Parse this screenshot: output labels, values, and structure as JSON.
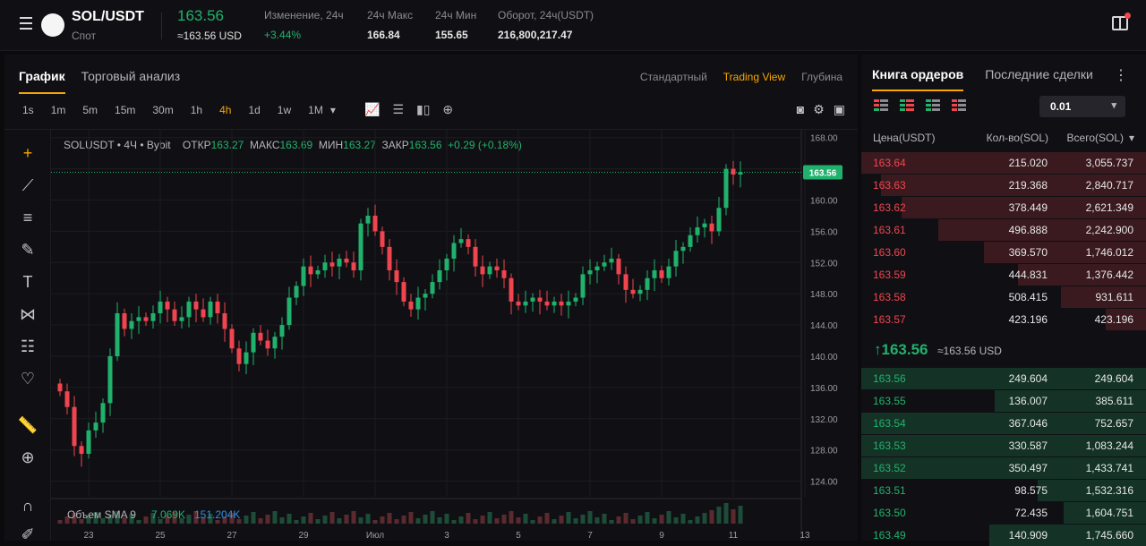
{
  "header": {
    "pair": "SOL/USDT",
    "type": "Спот",
    "price": "163.56",
    "price_usd": "≈163.56 USD",
    "stats": [
      {
        "label": "Изменение, 24ч",
        "value": "+3.44%",
        "positive": true
      },
      {
        "label": "24ч Макс",
        "value": "166.84"
      },
      {
        "label": "24ч Мин",
        "value": "155.65"
      },
      {
        "label": "Оборот, 24ч(USDT)",
        "value": "216,800,217.47"
      }
    ]
  },
  "chart_panel": {
    "tabs": [
      "График",
      "Торговый анализ"
    ],
    "views": [
      "Стандартный",
      "Trading View",
      "Глубина"
    ],
    "intervals": [
      "1s",
      "1m",
      "5m",
      "15m",
      "30m",
      "1h",
      "4h",
      "1d",
      "1w",
      "1M"
    ],
    "active_interval": "4h",
    "legend": {
      "symbol": "SOLUSDT",
      "tf": "4Ч",
      "exchange": "Bybit",
      "open_label": "ОТКР",
      "open": "163.27",
      "high_label": "МАКС",
      "high": "163.69",
      "low_label": "МИН",
      "low": "163.27",
      "close_label": "ЗАКР",
      "close": "163.56",
      "change": "+0.29 (+0.18%)"
    },
    "volume_legend": {
      "label": "Объем SMA 9",
      "v1": "7.069K",
      "v2": "151.204K"
    },
    "price_label": "163.56"
  },
  "chart_data": {
    "type": "candlestick",
    "ylim": [
      122,
      169
    ],
    "y_ticks": [
      124,
      128,
      132,
      136,
      140,
      144,
      148,
      152,
      156,
      160,
      164,
      168
    ],
    "y_tick_labels": [
      "124.00",
      "128.00",
      "132.00",
      "136.00",
      "140.00",
      "144.00",
      "148.00",
      "152.00",
      "156.00",
      "160.00",
      "164.00",
      "168.00"
    ],
    "x_tick_labels": [
      "23",
      "25",
      "27",
      "29",
      "Июл",
      "3",
      "5",
      "7",
      "9",
      "11",
      "13"
    ],
    "last_price": 163.56,
    "closes": [
      135.5,
      133.5,
      128.5,
      127.5,
      130.5,
      131.5,
      134.0,
      140.0,
      145.5,
      143.5,
      144.5,
      145.0,
      144.5,
      145.5,
      147.0,
      146.0,
      144.5,
      145.0,
      147.0,
      146.0,
      145.0,
      147.0,
      145.5,
      143.5,
      141.0,
      139.0,
      140.5,
      143.0,
      142.0,
      141.0,
      142.5,
      144.0,
      147.5,
      149.0,
      151.5,
      150.5,
      151.0,
      152.0,
      151.5,
      152.5,
      152.0,
      151.0,
      157.0,
      158.0,
      156.0,
      154.0,
      151.0,
      149.5,
      147.0,
      146.0,
      147.5,
      148.0,
      149.5,
      151.0,
      152.5,
      154.5,
      155.0,
      154.0,
      151.5,
      150.5,
      151.5,
      151.0,
      150.0,
      147.0,
      146.5,
      147.0,
      147.5,
      147.0,
      146.5,
      147.0,
      146.5,
      147.0,
      147.5,
      150.5,
      151.0,
      151.5,
      152.0,
      152.5,
      150.5,
      148.5,
      148.0,
      148.5,
      150.0,
      151.0,
      150.0,
      151.5,
      153.5,
      154.0,
      155.5,
      156.5,
      157.0,
      156.0,
      159.0,
      164.0,
      163.27,
      163.56
    ]
  },
  "order_book": {
    "tabs": [
      "Книга ордеров",
      "Последние сделки"
    ],
    "step": "0.01",
    "headers": {
      "price": "Цена(USDT)",
      "qty": "Кол-во(SOL)",
      "total": "Всего(SOL)"
    },
    "asks": [
      {
        "price": "163.64",
        "qty": "215.020",
        "total": "3,055.737",
        "depth": 1.0
      },
      {
        "price": "163.63",
        "qty": "219.368",
        "total": "2,840.717",
        "depth": 0.93
      },
      {
        "price": "163.62",
        "qty": "378.449",
        "total": "2,621.349",
        "depth": 0.86
      },
      {
        "price": "163.61",
        "qty": "496.888",
        "total": "2,242.900",
        "depth": 0.73
      },
      {
        "price": "163.60",
        "qty": "369.570",
        "total": "1,746.012",
        "depth": 0.57
      },
      {
        "price": "163.59",
        "qty": "444.831",
        "total": "1,376.442",
        "depth": 0.45
      },
      {
        "price": "163.58",
        "qty": "508.415",
        "total": "931.611",
        "depth": 0.3
      },
      {
        "price": "163.57",
        "qty": "423.196",
        "total": "423.196",
        "depth": 0.14
      }
    ],
    "mid_price": "163.56",
    "mid_usd": "≈163.56 USD",
    "bids": [
      {
        "price": "163.56",
        "qty": "249.604",
        "total": "249.604",
        "depth": 1.0
      },
      {
        "price": "163.55",
        "qty": "136.007",
        "total": "385.611",
        "depth": 0.53
      },
      {
        "price": "163.54",
        "qty": "367.046",
        "total": "752.657",
        "depth": 1.0
      },
      {
        "price": "163.53",
        "qty": "330.587",
        "total": "1,083.244",
        "depth": 1.0
      },
      {
        "price": "163.52",
        "qty": "350.497",
        "total": "1,433.741",
        "depth": 1.0
      },
      {
        "price": "163.51",
        "qty": "98.575",
        "total": "1,532.316",
        "depth": 0.38
      },
      {
        "price": "163.50",
        "qty": "72.435",
        "total": "1,604.751",
        "depth": 0.29
      },
      {
        "price": "163.49",
        "qty": "140.909",
        "total": "1,745.660",
        "depth": 0.55
      }
    ]
  },
  "colors": {
    "up": "#20b26c",
    "down": "#f0454f",
    "accent": "#f7a600"
  }
}
